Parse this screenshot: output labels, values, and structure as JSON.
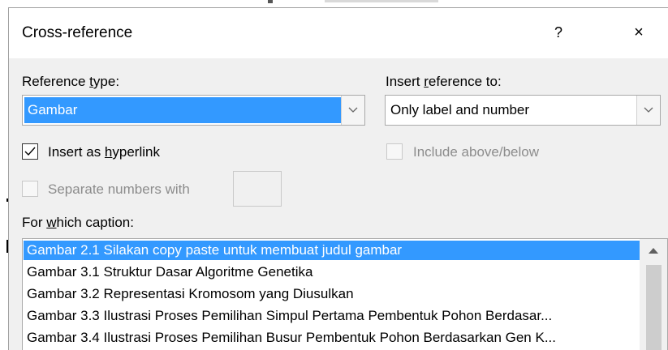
{
  "dialog": {
    "title": "Cross-reference",
    "help_label": "?",
    "close_label": "×"
  },
  "reference_type": {
    "label_pre": "Reference ",
    "label_key": "t",
    "label_post": "ype:",
    "selected": "Gambar"
  },
  "insert_reference_to": {
    "label_pre": "Insert ",
    "label_key": "r",
    "label_post": "eference to:",
    "selected": "Only label and number"
  },
  "insert_hyperlink": {
    "label_pre": "Insert as ",
    "label_key": "h",
    "label_post": "yperlink",
    "checked": true
  },
  "include_above_below": {
    "label": "Include above/below",
    "checked": false,
    "enabled": false
  },
  "separate_numbers": {
    "label": "Separate numbers with",
    "checked": false,
    "enabled": false,
    "value": ""
  },
  "caption_list": {
    "label_pre": "For ",
    "label_key": "w",
    "label_post": "hich caption:",
    "items": [
      "Gambar 2.1 Silakan copy paste untuk membuat judul gambar",
      "Gambar 3.1 Struktur Dasar Algoritme Genetika",
      "Gambar 3.2 Representasi Kromosom yang Diusulkan",
      "Gambar 3.3 Ilustrasi Proses Pemilihan Simpul Pertama Pembentuk Pohon Berdasar...",
      "Gambar 3.4 Ilustrasi Proses Pemilihan Busur Pembentuk Pohon Berdasarkan Gen K..."
    ],
    "selected_index": 0
  },
  "colors": {
    "selection": "#3399ff",
    "dialog_bg": "#f0f0f0"
  }
}
